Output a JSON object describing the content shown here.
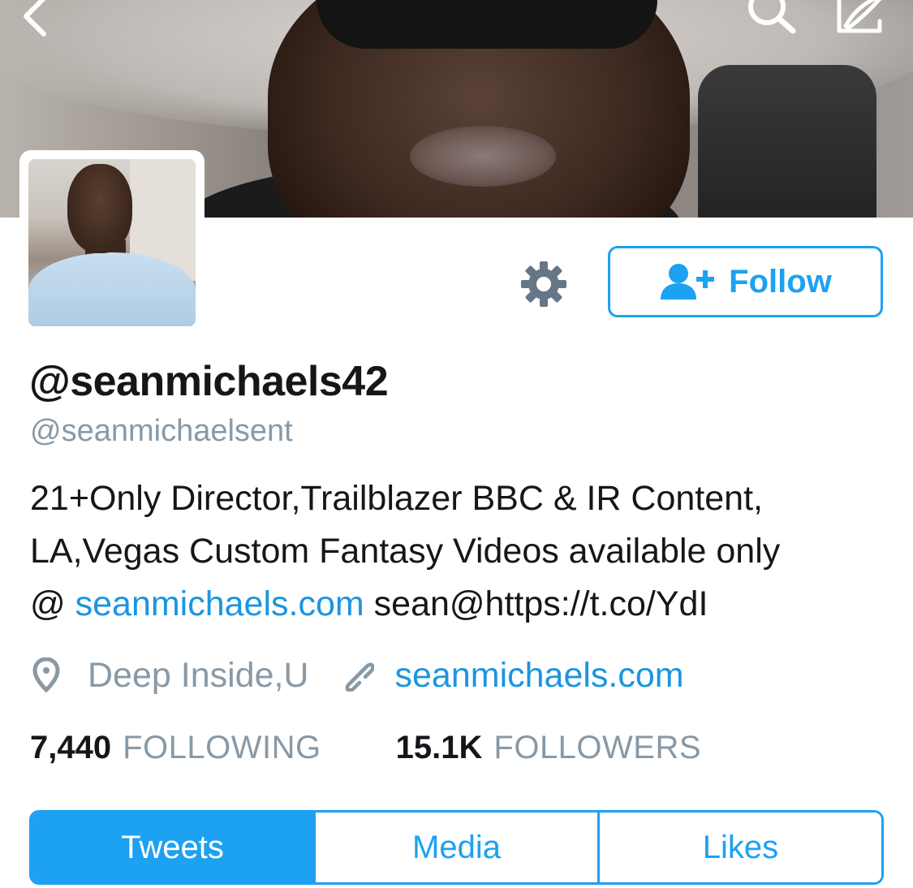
{
  "header": {
    "back_icon": "chevron-left-icon",
    "search_icon": "search-icon",
    "compose_icon": "compose-icon"
  },
  "profile": {
    "display_name": "@seanmichaels42",
    "handle": "@seanmichaelsent",
    "bio_line1": "21+Only Director,Trailblazer BBC & IR Content,",
    "bio_line2": "LA,Vegas Custom Fantasy Videos available only",
    "bio_line3_prefix": "@ ",
    "bio_link": "seanmichaels.com",
    "bio_line3_suffix": " sean@https://t.co/YdI",
    "location": "Deep Inside,U",
    "website": "seanmichaels.com"
  },
  "actions": {
    "settings_icon": "gear-icon",
    "follow_label": "Follow",
    "follow_icon": "add-user-icon"
  },
  "stats": {
    "following_count": "7,440",
    "following_label": "FOLLOWING",
    "followers_count": "15.1K",
    "followers_label": "FOLLOWERS"
  },
  "tabs": [
    {
      "label": "Tweets",
      "active": true
    },
    {
      "label": "Media",
      "active": false
    },
    {
      "label": "Likes",
      "active": false
    }
  ],
  "colors": {
    "accent": "#1da1f2",
    "link": "#1b95e0",
    "text_primary": "#14171a",
    "text_secondary": "#8899a6",
    "icon_gray": "#657786"
  }
}
